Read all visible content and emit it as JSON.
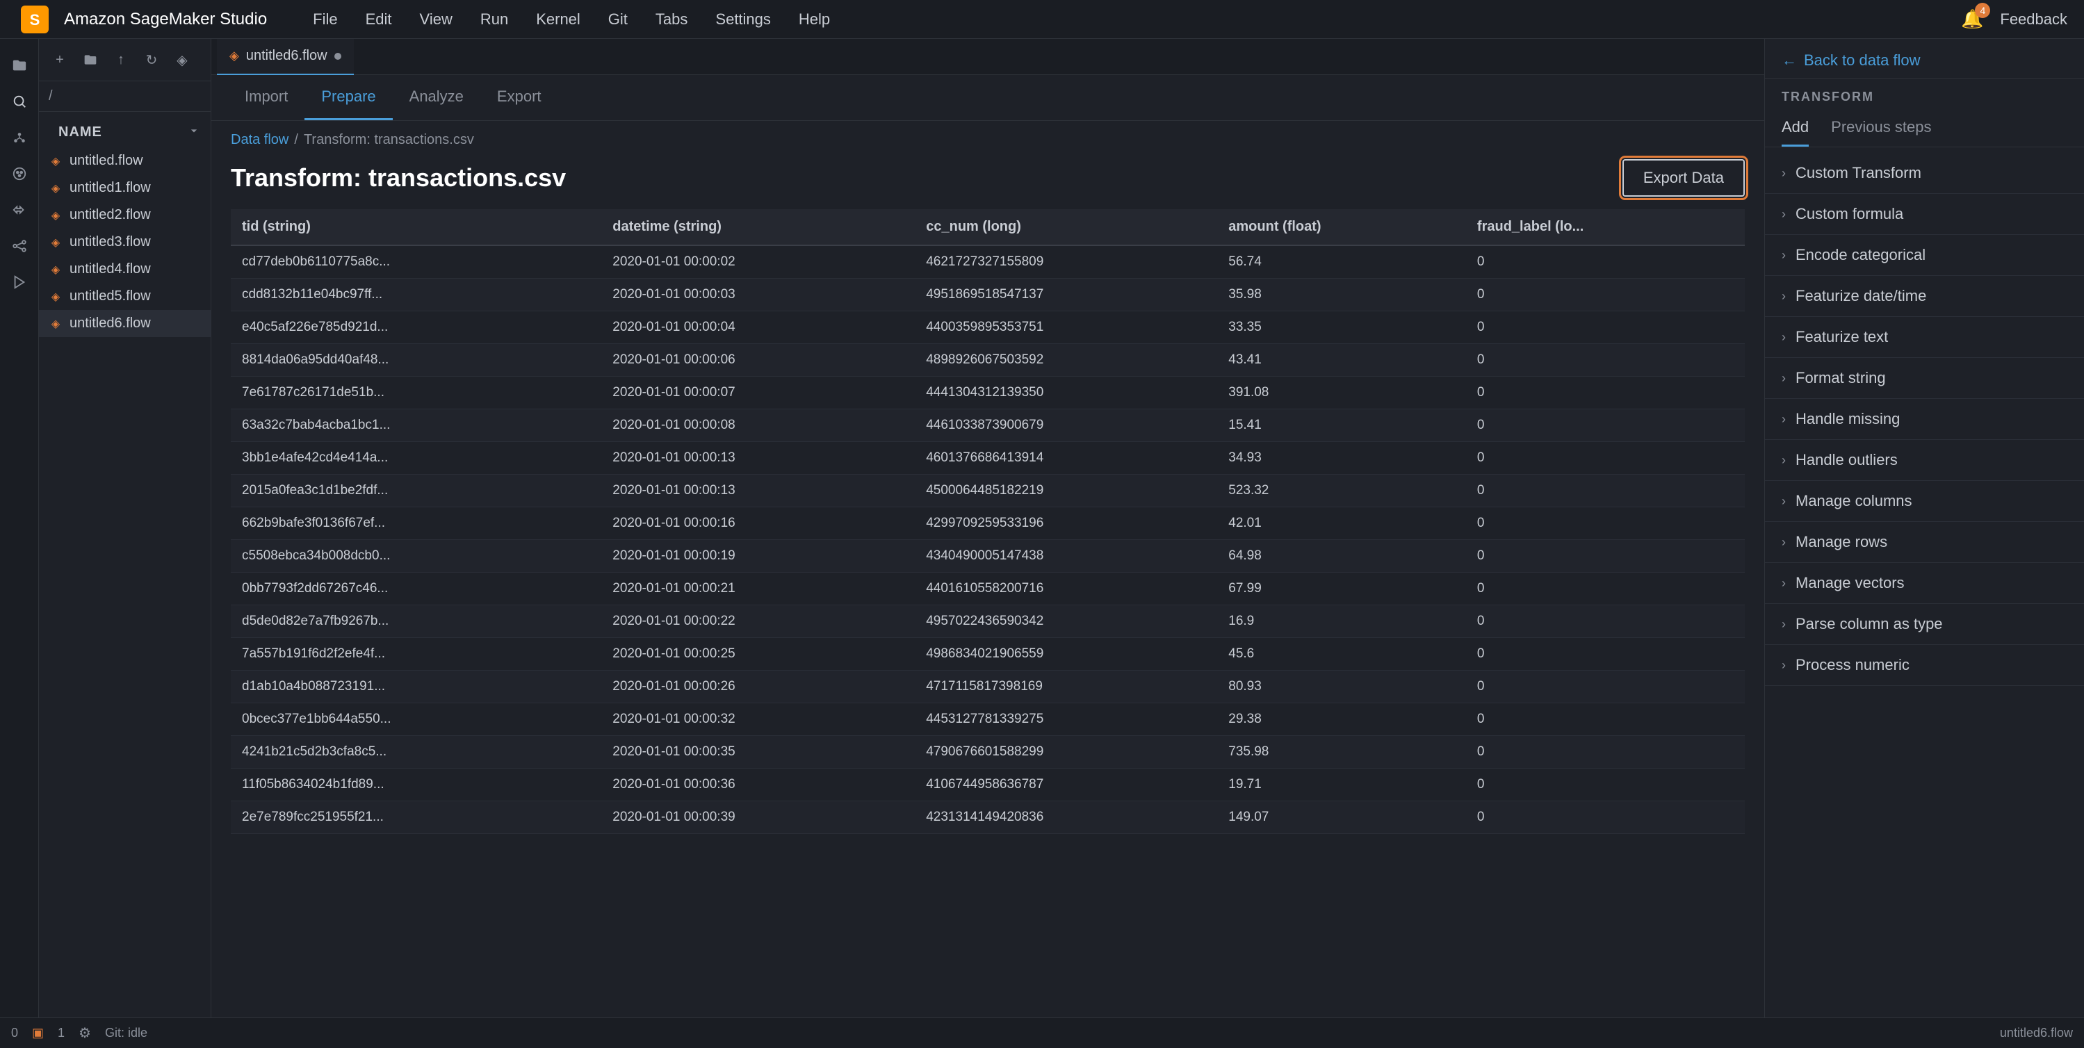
{
  "app": {
    "name": "Amazon SageMaker Studio",
    "feedback_label": "Feedback",
    "notification_count": "4"
  },
  "menu": {
    "items": [
      "File",
      "Edit",
      "View",
      "Run",
      "Kernel",
      "Git",
      "Tabs",
      "Settings",
      "Help"
    ]
  },
  "tab_bar": {
    "active_tab": "untitled6.flow",
    "tab_icon": "◈"
  },
  "nav_tabs": {
    "items": [
      "Import",
      "Prepare",
      "Analyze",
      "Export"
    ],
    "active": "Prepare"
  },
  "breadcrumb": {
    "link": "Data flow",
    "separator": "/",
    "current": "Transform: transactions.csv"
  },
  "page": {
    "title": "Transform: transactions.csv",
    "export_btn": "Export Data"
  },
  "table": {
    "columns": [
      "tid (string)",
      "datetime (string)",
      "cc_num (long)",
      "amount (float)",
      "fraud_label (lo..."
    ],
    "rows": [
      [
        "cd77deb0b6110775a8c...",
        "2020-01-01 00:00:02",
        "4621727327155809",
        "56.74",
        "0"
      ],
      [
        "cdd8132b11e04bc97ff...",
        "2020-01-01 00:00:03",
        "4951869518547137",
        "35.98",
        "0"
      ],
      [
        "e40c5af226e785d921d...",
        "2020-01-01 00:00:04",
        "4400359895353751",
        "33.35",
        "0"
      ],
      [
        "8814da06a95dd40af48...",
        "2020-01-01 00:00:06",
        "4898926067503592",
        "43.41",
        "0"
      ],
      [
        "7e61787c26171de51b...",
        "2020-01-01 00:00:07",
        "4441304312139350",
        "391.08",
        "0"
      ],
      [
        "63a32c7bab4acba1bc1...",
        "2020-01-01 00:00:08",
        "4461033873900679",
        "15.41",
        "0"
      ],
      [
        "3bb1e4afe42cd4e414a...",
        "2020-01-01 00:00:13",
        "4601376686413914",
        "34.93",
        "0"
      ],
      [
        "2015a0fea3c1d1be2fdf...",
        "2020-01-01 00:00:13",
        "4500064485182219",
        "523.32",
        "0"
      ],
      [
        "662b9bafe3f0136f67ef...",
        "2020-01-01 00:00:16",
        "4299709259533196",
        "42.01",
        "0"
      ],
      [
        "c5508ebca34b008dcb0...",
        "2020-01-01 00:00:19",
        "4340490005147438",
        "64.98",
        "0"
      ],
      [
        "0bb7793f2dd67267c46...",
        "2020-01-01 00:00:21",
        "4401610558200716",
        "67.99",
        "0"
      ],
      [
        "d5de0d82e7a7fb9267b...",
        "2020-01-01 00:00:22",
        "4957022436590342",
        "16.9",
        "0"
      ],
      [
        "7a557b191f6d2f2efe4f...",
        "2020-01-01 00:00:25",
        "4986834021906559",
        "45.6",
        "0"
      ],
      [
        "d1ab10a4b088723191...",
        "2020-01-01 00:00:26",
        "4717115817398169",
        "80.93",
        "0"
      ],
      [
        "0bcec377e1bb644a550...",
        "2020-01-01 00:00:32",
        "4453127781339275",
        "29.38",
        "0"
      ],
      [
        "4241b21c5d2b3cfa8c5...",
        "2020-01-01 00:00:35",
        "4790676601588299",
        "735.98",
        "0"
      ],
      [
        "11f05b8634024b1fd89...",
        "2020-01-01 00:00:36",
        "4106744958636787",
        "19.71",
        "0"
      ],
      [
        "2e7e789fcc251955f21...",
        "2020-01-01 00:00:39",
        "4231314149420836",
        "149.07",
        "0"
      ]
    ]
  },
  "file_sidebar": {
    "section_title": "NAME",
    "path": "/",
    "files": [
      "untitled.flow",
      "untitled1.flow",
      "untitled2.flow",
      "untitled3.flow",
      "untitled4.flow",
      "untitled5.flow",
      "untitled6.flow"
    ]
  },
  "right_panel": {
    "back_link": "Back to data flow",
    "section_title": "TRANSFORM",
    "tabs": [
      "Add",
      "Previous steps"
    ],
    "active_tab": "Add",
    "transforms": [
      "Custom Transform",
      "Custom formula",
      "Encode categorical",
      "Featurize date/time",
      "Featurize text",
      "Format string",
      "Handle missing",
      "Handle outliers",
      "Manage columns",
      "Manage rows",
      "Manage vectors",
      "Parse column as type",
      "Process numeric"
    ]
  },
  "status_bar": {
    "item1": "0",
    "item2": "1",
    "git_status": "Git: idle",
    "right_label": "untitled6.flow"
  }
}
